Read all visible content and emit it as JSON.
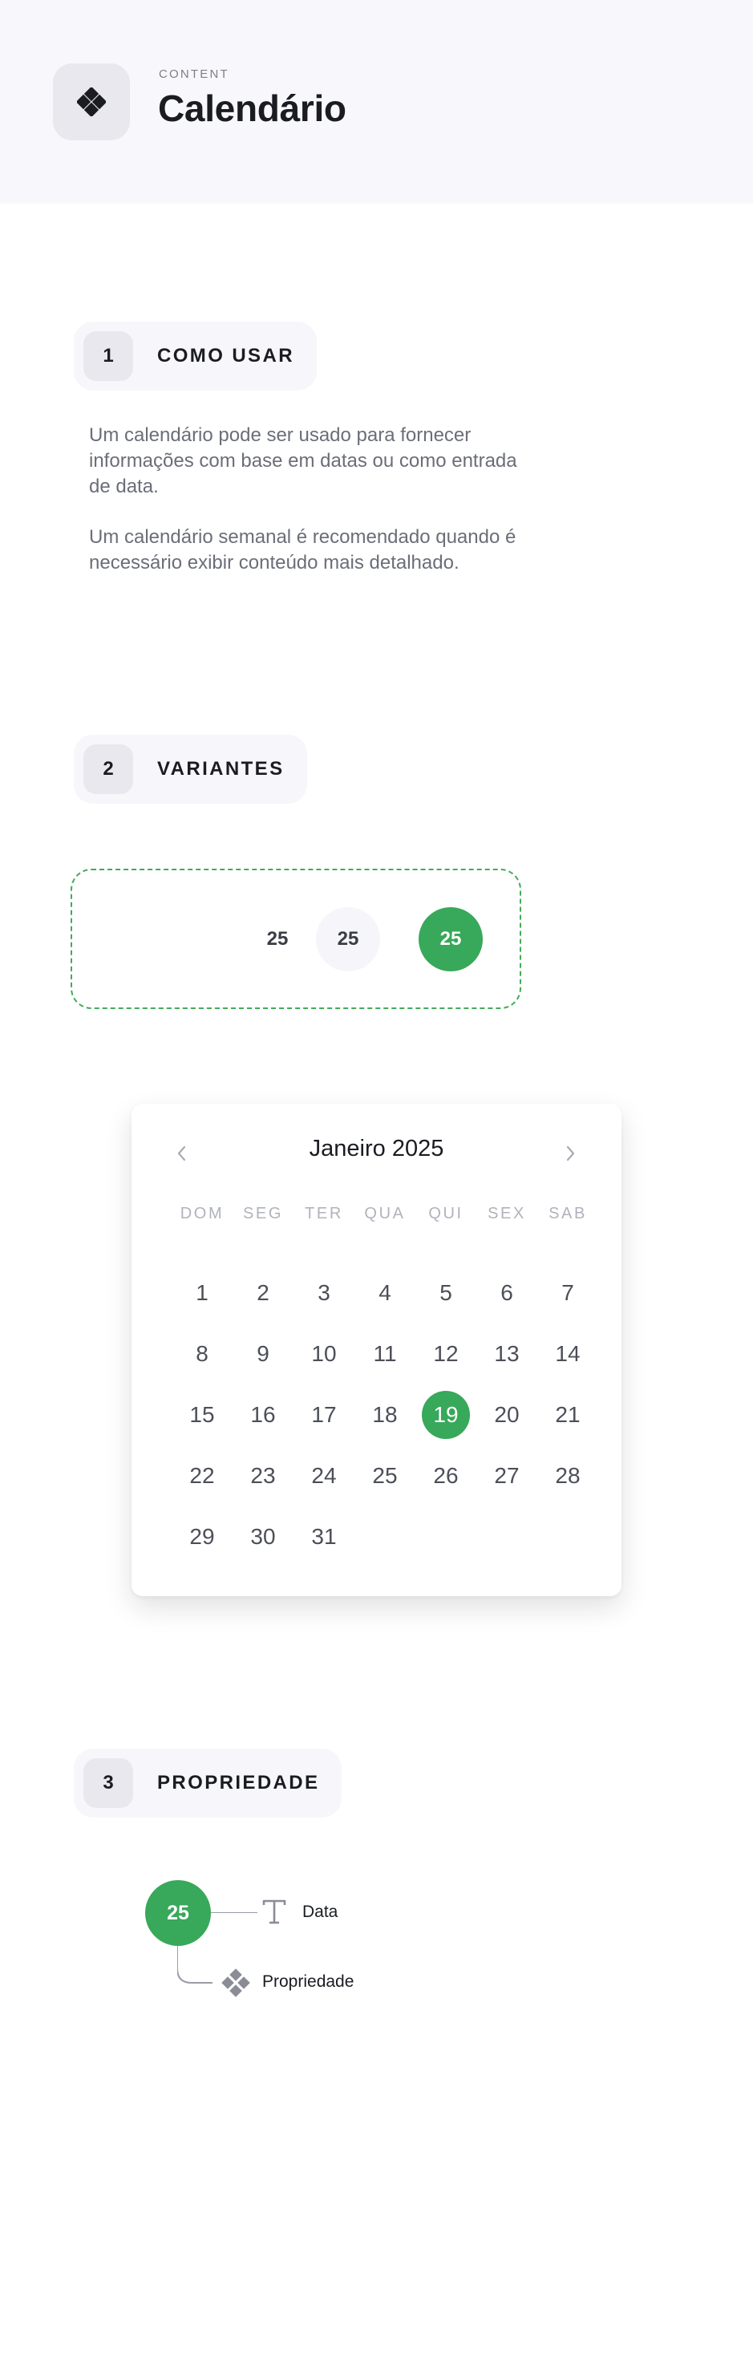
{
  "header": {
    "kicker": "CONTENT",
    "title": "Calendário",
    "icon": "component-diamond-icon"
  },
  "sections": [
    {
      "number": "1",
      "label": "COMO USAR"
    },
    {
      "number": "2",
      "label": "VARIANTES"
    },
    {
      "number": "3",
      "label": "PROPRIEDADE"
    }
  ],
  "usage": {
    "paragraph_1": "Um calendário pode ser usado para fornecer informações com base em datas ou como entrada de data.",
    "paragraph_2": "Um calendário semanal é recomendado quando é necessário exibir conteúdo mais detalhado."
  },
  "variants": {
    "states": [
      "25",
      "25",
      "25"
    ],
    "accent_color": "#38a85a",
    "dash_color": "#42ab5a"
  },
  "calendar": {
    "month_title": "Janeiro 2025",
    "prev_icon": "chevron-left-icon",
    "next_icon": "chevron-right-icon",
    "weekdays": [
      "DOM",
      "SEG",
      "TER",
      "QUA",
      "QUI",
      "SEX",
      "SAB"
    ],
    "days": [
      "1",
      "2",
      "3",
      "4",
      "5",
      "6",
      "7",
      "8",
      "9",
      "10",
      "11",
      "12",
      "13",
      "14",
      "15",
      "16",
      "17",
      "18",
      "19",
      "20",
      "21",
      "22",
      "23",
      "24",
      "25",
      "26",
      "27",
      "28",
      "29",
      "30",
      "31"
    ],
    "selected_day": "19",
    "selected_color": "#38a85a"
  },
  "property": {
    "sample_day": "25",
    "data_label": "Data",
    "data_icon": "text-type-icon",
    "property_label": "Propriedade",
    "property_icon": "component-diamond-icon"
  }
}
